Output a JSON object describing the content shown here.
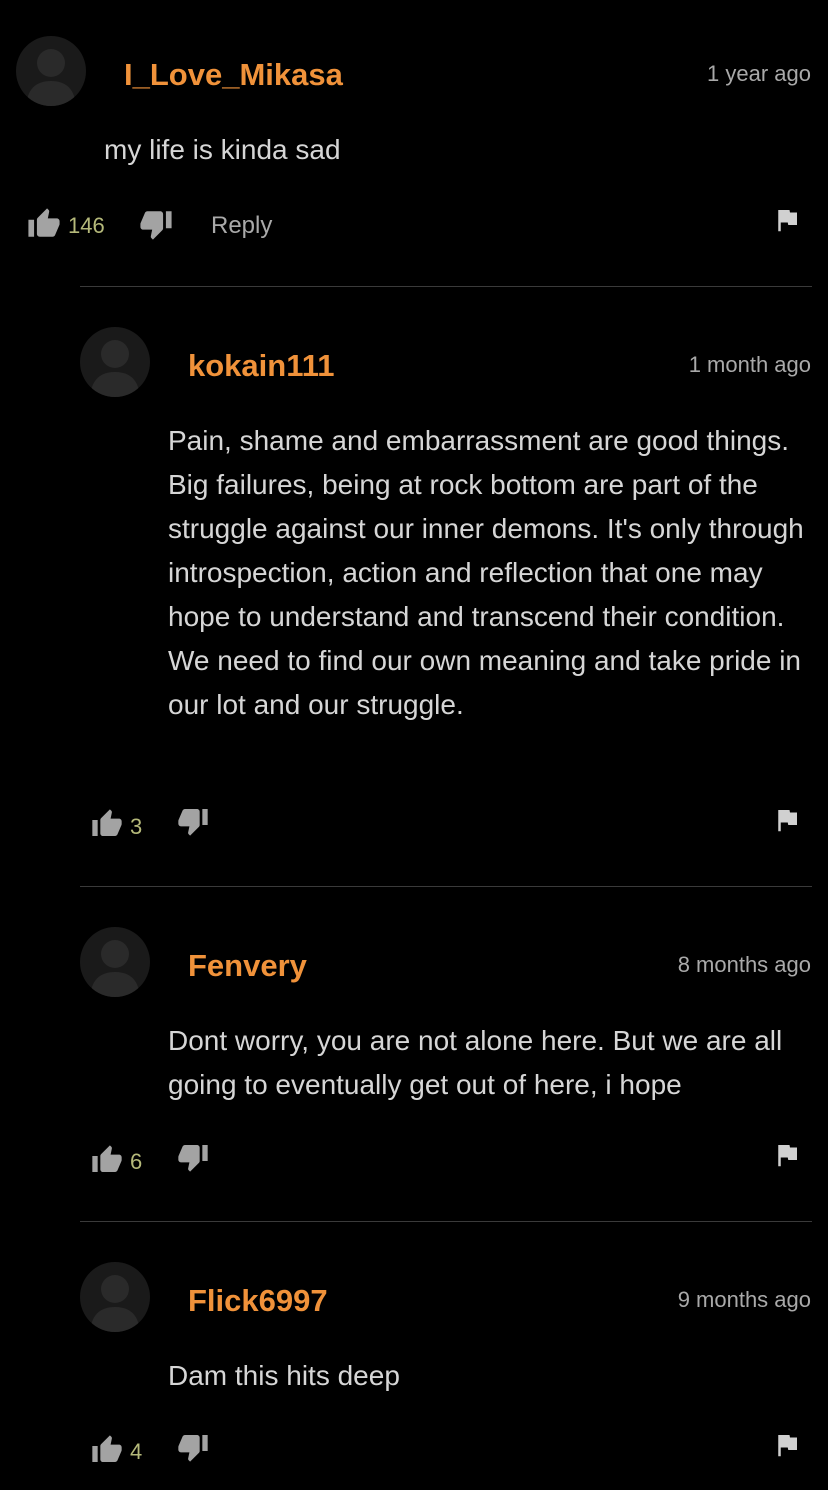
{
  "colors": {
    "background": "#000000",
    "username": "#f0923a",
    "like_count": "#b5b97a",
    "muted": "#a9a9a9",
    "body_text": "#d6d6d6"
  },
  "icons": {
    "like": "thumbs-up-icon",
    "dislike": "thumbs-down-icon",
    "flag": "flag-icon",
    "avatar": "default-user-avatar"
  },
  "comments": [
    {
      "username": "I_Love_Mikasa",
      "time": "1 year ago",
      "text": "my life is kinda sad",
      "likes": "146",
      "reply_label": "Reply"
    },
    {
      "username": "kokain111",
      "time": "1 month ago",
      "text": "Pain, shame and embarrassment are good things. Big failures, being at rock bottom are part of the struggle against our inner demons. It's only through introspection, action and reflection that one may hope to understand and transcend their condition. We need to find our own meaning and take pride in our lot and our struggle.",
      "likes": "3"
    },
    {
      "username": "Fenvery",
      "time": "8 months ago",
      "text": "Dont worry, you are not alone here. But we are all going to eventually get out of here, i hope",
      "likes": "6"
    },
    {
      "username": "Flick6997",
      "time": "9 months ago",
      "text": "Dam this hits deep",
      "likes": "4"
    }
  ]
}
